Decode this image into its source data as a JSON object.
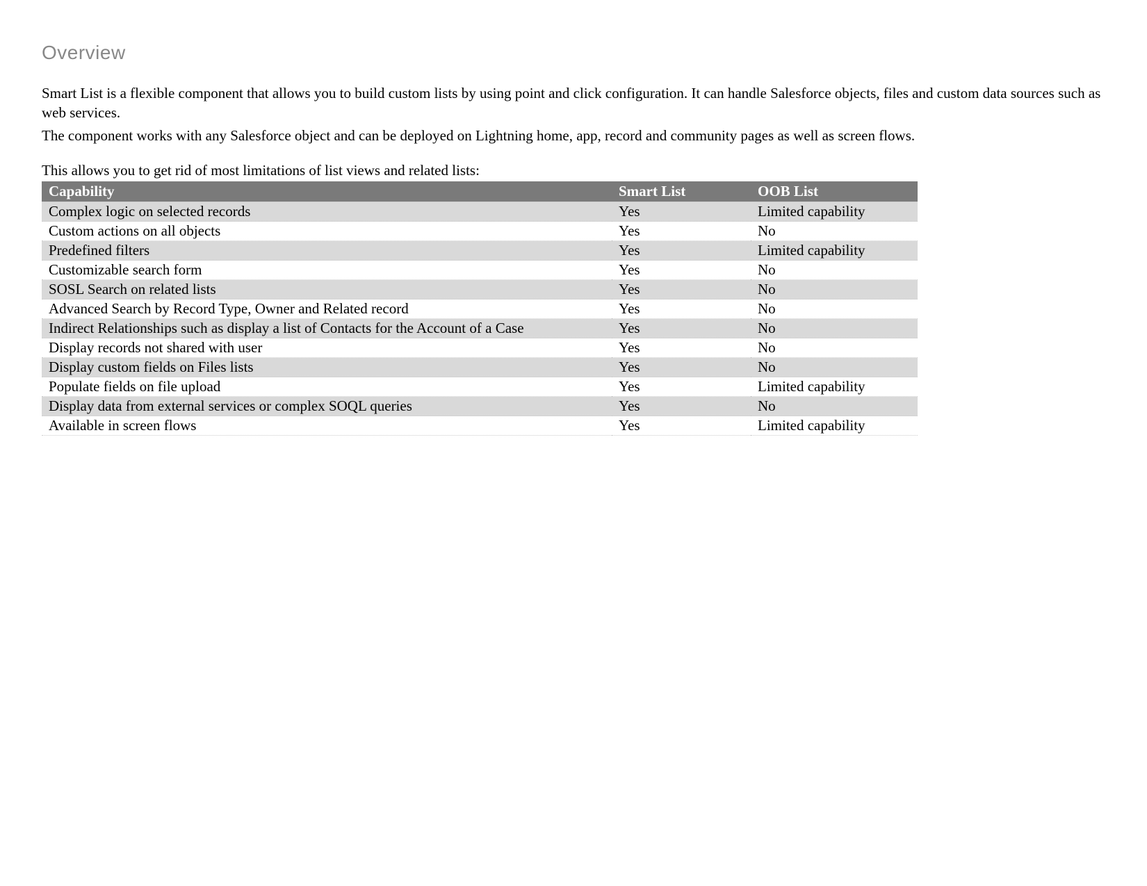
{
  "heading": "Overview",
  "para1": "Smart List is a flexible component that allows you to build custom lists by using point and click configuration. It can handle Salesforce objects, files and custom data sources such as web services.",
  "para2": "The component works with any Salesforce object and can be deployed on Lightning home, app, record and community pages as well as screen flows.",
  "intro": "This allows you to get rid of most limitations of list views and related lists:",
  "table": {
    "headers": [
      "Capability",
      "Smart List",
      "OOB List"
    ],
    "rows": [
      {
        "cells": [
          "Complex logic on selected records",
          "Yes",
          "Limited capability"
        ]
      },
      {
        "cells": [
          "Custom actions on all objects",
          "Yes",
          "No"
        ]
      },
      {
        "cells": [
          "Predefined filters",
          "Yes",
          "Limited capability"
        ]
      },
      {
        "cells": [
          "Customizable search form",
          "Yes",
          "No"
        ]
      },
      {
        "cells": [
          "SOSL Search on related lists",
          "Yes",
          "No"
        ]
      },
      {
        "cells": [
          "Advanced Search by Record Type, Owner and Related record",
          "Yes",
          "No"
        ]
      },
      {
        "cells": [
          "Indirect Relationships such as display a list of Contacts for the Account of a Case",
          "Yes",
          "No"
        ]
      },
      {
        "cells": [
          "Display records not shared with user",
          "Yes",
          "No"
        ]
      },
      {
        "cells": [
          "Display custom fields on Files lists",
          "Yes",
          "No"
        ]
      },
      {
        "cells": [
          "Populate fields on file upload",
          "Yes",
          "Limited capability"
        ]
      },
      {
        "cells": [
          "Display data from external services or complex SOQL queries",
          "Yes",
          "No"
        ]
      },
      {
        "cells": [
          "Available in screen flows",
          "Yes",
          "Limited capability"
        ]
      }
    ]
  },
  "chart_data": {
    "type": "table",
    "title": "Smart List vs OOB List capability comparison",
    "columns": [
      "Capability",
      "Smart List",
      "OOB List"
    ],
    "rows": [
      [
        "Complex logic on selected records",
        "Yes",
        "Limited capability"
      ],
      [
        "Custom actions on all objects",
        "Yes",
        "No"
      ],
      [
        "Predefined filters",
        "Yes",
        "Limited capability"
      ],
      [
        "Customizable search form",
        "Yes",
        "No"
      ],
      [
        "SOSL Search on related lists",
        "Yes",
        "No"
      ],
      [
        "Advanced Search by Record Type, Owner and Related record",
        "Yes",
        "No"
      ],
      [
        "Indirect Relationships such as display a list of Contacts for the Account of a Case",
        "Yes",
        "No"
      ],
      [
        "Display records not shared with user",
        "Yes",
        "No"
      ],
      [
        "Display custom fields on Files lists",
        "Yes",
        "No"
      ],
      [
        "Populate fields on file upload",
        "Yes",
        "Limited capability"
      ],
      [
        "Display data from external services or complex SOQL queries",
        "Yes",
        "No"
      ],
      [
        "Available in screen flows",
        "Yes",
        "Limited capability"
      ]
    ]
  }
}
